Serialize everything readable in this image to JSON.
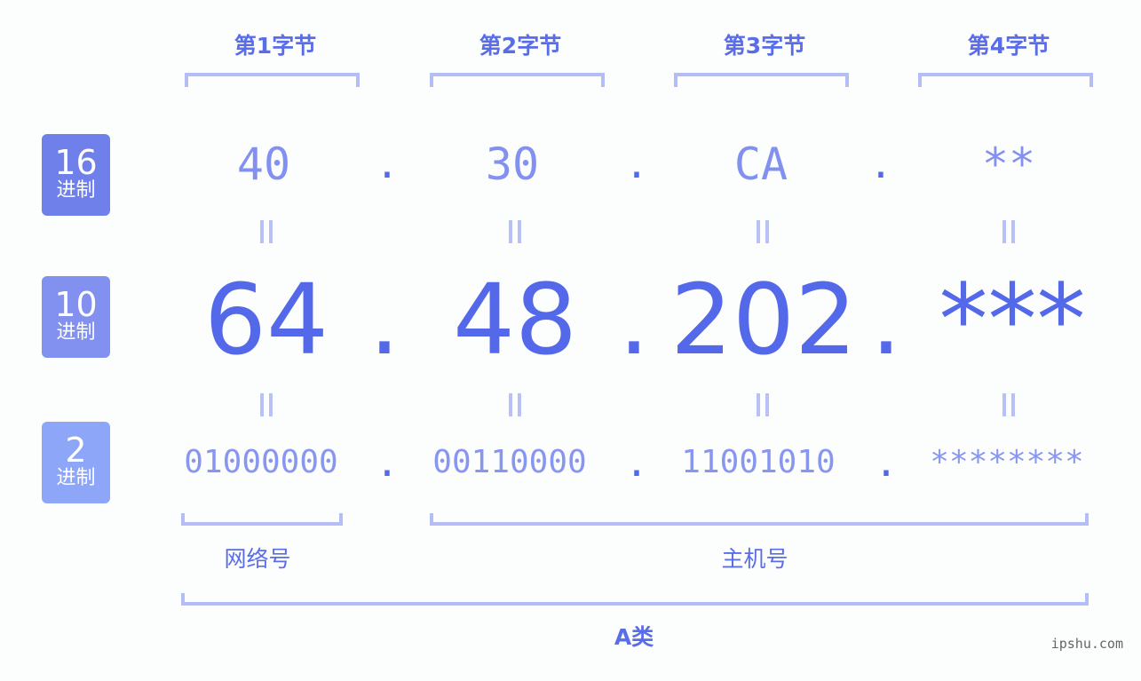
{
  "bytes": [
    {
      "label": "第1字节",
      "hex": "40",
      "dec": "64",
      "bin": "01000000"
    },
    {
      "label": "第2字节",
      "hex": "30",
      "dec": "48",
      "bin": "00110000"
    },
    {
      "label": "第3字节",
      "hex": "CA",
      "dec": "202",
      "bin": "11001010"
    },
    {
      "label": "第4字节",
      "hex": "**",
      "dec": "***",
      "bin": "********"
    }
  ],
  "separator": ".",
  "rows": [
    {
      "num": "16",
      "unit": "进制",
      "color": "#7080ea"
    },
    {
      "num": "10",
      "unit": "进制",
      "color": "#8291f0"
    },
    {
      "num": "2",
      "unit": "进制",
      "color": "#8ea6f8"
    }
  ],
  "sections": {
    "network": "网络号",
    "host": "主机号",
    "class": "A类"
  },
  "watermark": "ipshu.com",
  "colors": {
    "accent": "#5468ea",
    "bracket": "#b4bdf6"
  }
}
